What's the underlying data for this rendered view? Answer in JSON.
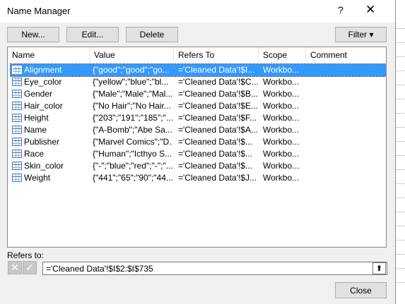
{
  "window": {
    "title": "Name Manager",
    "help": "?",
    "close": "✕"
  },
  "toolbar": {
    "new_label": "New...",
    "edit_label": "Edit...",
    "delete_label": "Delete",
    "filter_label": "Filter ▾"
  },
  "columns": [
    "Name",
    "Value",
    "Refers To",
    "Scope",
    "Comment"
  ],
  "rows": [
    {
      "name": "Alignment",
      "value": "{\"good\";\"good\";\"go...",
      "refers": "='Cleaned Data'!$I...",
      "scope": "Workbo...",
      "comment": ""
    },
    {
      "name": "Eye_color",
      "value": "{\"yellow\";\"blue\";\"bl...",
      "refers": "='Cleaned Data'!$C...",
      "scope": "Workbo...",
      "comment": ""
    },
    {
      "name": "Gender",
      "value": "{\"Male\";\"Male\";\"Mal...",
      "refers": "='Cleaned Data'!$B...",
      "scope": "Workbo...",
      "comment": ""
    },
    {
      "name": "Hair_color",
      "value": "{\"No Hair\";\"No Hair...",
      "refers": "='Cleaned Data'!$E...",
      "scope": "Workbo...",
      "comment": ""
    },
    {
      "name": "Height",
      "value": "{\"203\";\"191\";\"185\";\"...",
      "refers": "='Cleaned Data'!$F...",
      "scope": "Workbo...",
      "comment": ""
    },
    {
      "name": "Name",
      "value": "{\"A-Bomb\";\"Abe Sa...",
      "refers": "='Cleaned Data'!$A...",
      "scope": "Workbo...",
      "comment": ""
    },
    {
      "name": "Publisher",
      "value": "{\"Marvel Comics\";\"D...",
      "refers": "='Cleaned Data'!$...",
      "scope": "Workbo...",
      "comment": ""
    },
    {
      "name": "Race",
      "value": "{\"Human\";\"Icthyo S...",
      "refers": "='Cleaned Data'!$...",
      "scope": "Workbo...",
      "comment": ""
    },
    {
      "name": "Skin_color",
      "value": "{\"-\";\"blue\";\"red\";\"-\";\"...",
      "refers": "='Cleaned Data'!$...",
      "scope": "Workbo...",
      "comment": ""
    },
    {
      "name": "Weight",
      "value": "{\"441\";\"65\";\"90\";\"44...",
      "refers": "='Cleaned Data'!$J...",
      "scope": "Workbo...",
      "comment": ""
    }
  ],
  "refers_to": {
    "label": "Refers to:",
    "value": "='Cleaned Data'!$I$2:$I$735"
  },
  "footer": {
    "close_label": "Close"
  },
  "colors": {
    "selection": "#3399ff",
    "dialog_bg": "#f0f0f0",
    "button_bg": "#e1e1e1"
  },
  "icons": {
    "row": "table-icon",
    "cancel": "x-icon",
    "confirm": "check-icon",
    "collapse": "collapse-dialog-icon"
  }
}
